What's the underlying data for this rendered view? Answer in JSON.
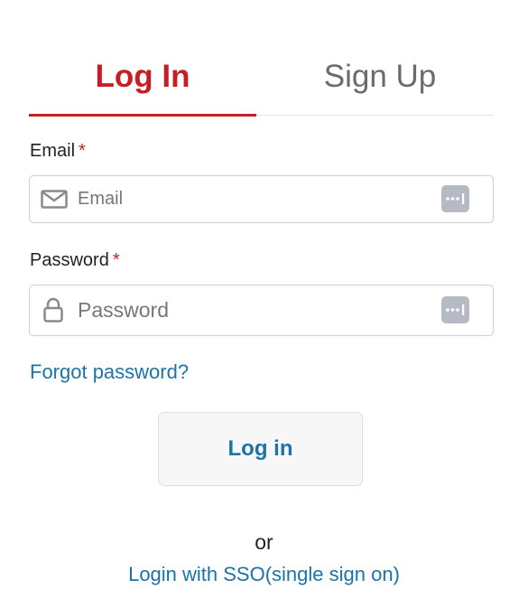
{
  "tabs": {
    "login_label": "Log In",
    "signup_label": "Sign Up",
    "active": "login"
  },
  "form": {
    "email": {
      "label": "Email",
      "required_mark": "*",
      "placeholder": "Email",
      "value": "",
      "icon": "envelope-icon",
      "trailing_icon": "password-manager-icon"
    },
    "password": {
      "label": "Password",
      "required_mark": "*",
      "placeholder": "Password",
      "value": "",
      "icon": "lock-icon",
      "trailing_icon": "password-manager-icon"
    },
    "forgot_label": "Forgot password?",
    "submit_label": "Log in"
  },
  "footer": {
    "or_text": "or",
    "sso_label": "Login with SSO(single sign on)"
  },
  "colors": {
    "accent": "#c41f24",
    "link": "#1b73a8",
    "inactive_tab": "#6b6b6b",
    "border": "#cfcfcf",
    "pm_icon_bg": "#b5bac4"
  }
}
